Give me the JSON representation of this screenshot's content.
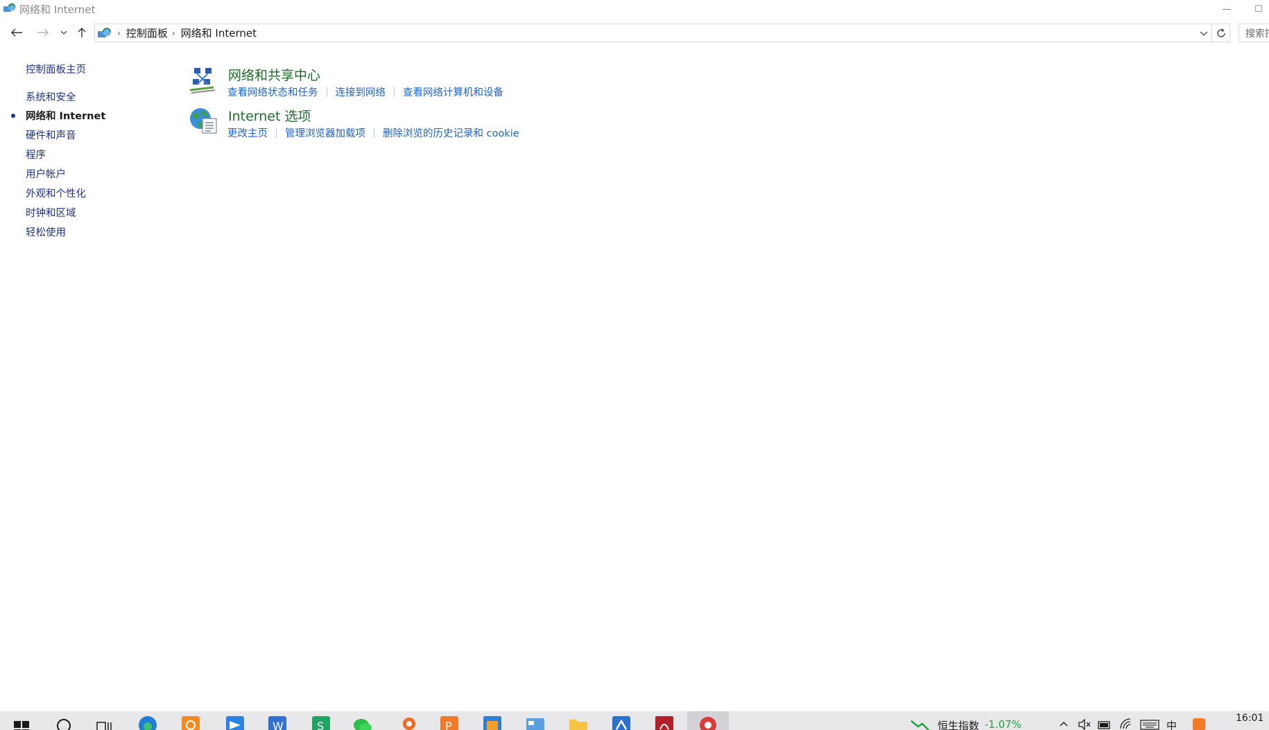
{
  "window": {
    "title": "网络和 Internet",
    "minimize_glyph": "—",
    "maximize_glyph": "☐"
  },
  "address": {
    "crumbs": [
      "控制面板",
      "网络和 Internet"
    ],
    "search_placeholder": "搜索控"
  },
  "sidebar": {
    "home": "控制面板主页",
    "items": [
      {
        "label": "系统和安全",
        "active": false
      },
      {
        "label": "网络和 Internet",
        "active": true
      },
      {
        "label": "硬件和声音",
        "active": false
      },
      {
        "label": "程序",
        "active": false
      },
      {
        "label": "用户帐户",
        "active": false
      },
      {
        "label": "外观和个性化",
        "active": false
      },
      {
        "label": "时钟和区域",
        "active": false
      },
      {
        "label": "轻松使用",
        "active": false
      }
    ]
  },
  "categories": [
    {
      "title": "网络和共享中心",
      "icon": "network-sharing-center-icon",
      "links": [
        "查看网络状态和任务",
        "连接到网络",
        "查看网络计算机和设备"
      ]
    },
    {
      "title": "Internet 选项",
      "icon": "internet-options-icon",
      "links": [
        "更改主页",
        "管理浏览器加载项",
        "删除浏览的历史记录和 cookie"
      ]
    }
  ],
  "taskbar": {
    "stock_name": "恒生指数",
    "stock_change": "-1.07%",
    "ime": "中",
    "clock": "16:01"
  },
  "colors": {
    "link": "#1e63c8",
    "nav_link": "#1e3287",
    "category_title": "#1c6e2a",
    "stock_green": "#1aa53a"
  }
}
